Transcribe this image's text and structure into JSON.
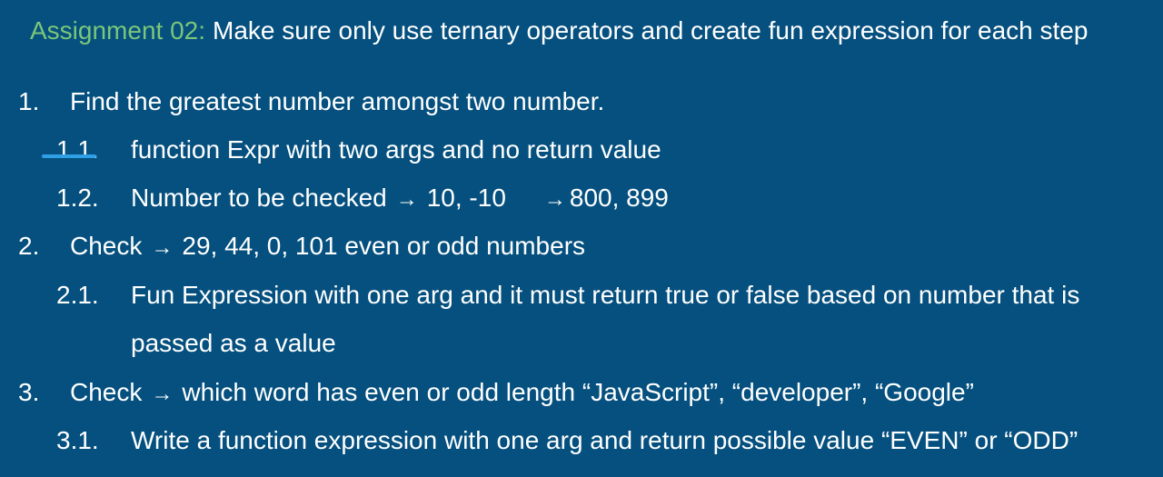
{
  "title": {
    "label": "Assignment 02:",
    "text": "Make sure only use ternary operators and create fun expression for each step"
  },
  "items": [
    {
      "num": "1.",
      "text": "Find the greatest number amongst two number."
    },
    {
      "num": "1.1.",
      "text": "function Expr  with two args and no return value"
    },
    {
      "num": "1.2.",
      "text_a": "Number to be checked",
      "arrow_a": "→",
      "text_b": "10, -10",
      "arrow_b": "→",
      "text_c": "800, 899"
    },
    {
      "num": "2.",
      "text_a": "Check",
      "arrow": "→",
      "text_b": "29, 44, 0, 101 even or odd numbers"
    },
    {
      "num": "2.1.",
      "text_line1": "Fun Expression with one arg and it must return true or false based on number that is",
      "text_line2": "passed as a value"
    },
    {
      "num": "3.",
      "text_a": "Check",
      "arrow": "→",
      "text_b": "which word has even or odd length “JavaScript”, “developer”, “Google”"
    },
    {
      "num": "3.1.",
      "text": "Write a function expression with one arg and return possible value “EVEN” or “ODD”"
    }
  ],
  "colors": {
    "background": "#05507f",
    "title_label": "#7bc67a",
    "text": "#ffffff",
    "strike": "#2f9fe6"
  }
}
